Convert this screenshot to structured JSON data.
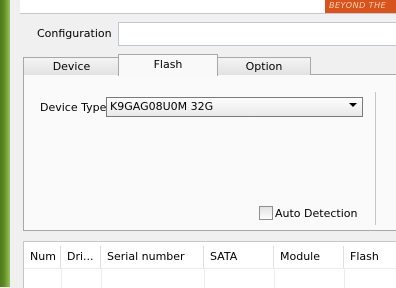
{
  "config": {
    "label": "Configuration",
    "value": ""
  },
  "logo": {
    "text": "BEYOND THE"
  },
  "tabs": [
    {
      "label": "Device",
      "active": false
    },
    {
      "label": "Flash",
      "active": true
    },
    {
      "label": "Option",
      "active": false
    }
  ],
  "flash": {
    "device_type_label": "Device Type",
    "device_type_value": "K9GAG08U0M 32G",
    "auto_detection_label": "Auto Detection",
    "auto_detection_checked": false
  },
  "table": {
    "columns": [
      "Num",
      "Dri...",
      "Serial number",
      "SATA",
      "Module",
      "Flash"
    ]
  },
  "colors": {
    "accent_green": "#5d8b23",
    "logo_orange": "#d9531e"
  }
}
